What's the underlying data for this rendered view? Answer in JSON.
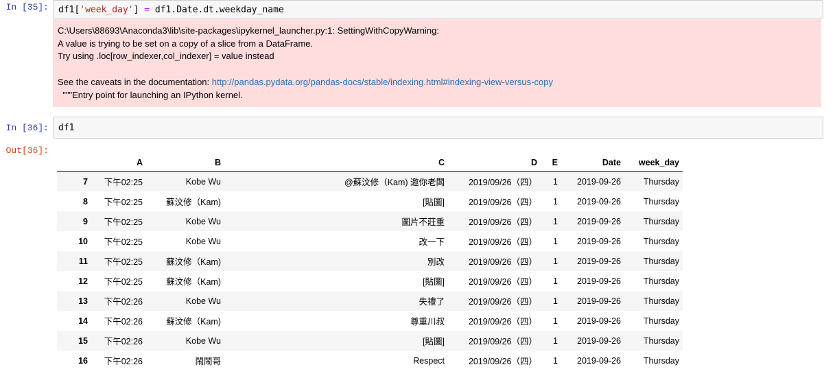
{
  "cell35": {
    "prompt": "In [35]:",
    "code": {
      "p1": "df1[",
      "p2": "'week_day'",
      "p3": "] ",
      "p4": "=",
      "p5": " df1.Date.dt.weekday_name"
    },
    "stderr": {
      "line1": "C:\\Users\\88693\\Anaconda3\\lib\\site-packages\\ipykernel_launcher.py:1: SettingWithCopyWarning:",
      "line2": "A value is trying to be set on a copy of a slice from a DataFrame.",
      "line3": "Try using .loc[row_indexer,col_indexer] = value instead",
      "line4_prefix": "See the caveats in the documentation: ",
      "line4_link": "http://pandas.pydata.org/pandas-docs/stable/indexing.html#indexing-view-versus-copy",
      "line5": "  \"\"\"Entry point for launching an IPython kernel."
    }
  },
  "cell36": {
    "prompt": "In [36]:",
    "code": "df1",
    "out_prompt": "Out[36]:"
  },
  "table": {
    "columns": [
      "",
      "A",
      "B",
      "C",
      "D",
      "E",
      "Date",
      "week_day"
    ],
    "rows": [
      [
        "7",
        "下午02:25",
        "Kobe Wu",
        "@蘇汶修（Kam) 邀你老闆",
        "2019/09/26（四）",
        "1",
        "2019-09-26",
        "Thursday"
      ],
      [
        "8",
        "下午02:25",
        "蘇汶修（Kam)",
        "[貼圖]",
        "2019/09/26（四）",
        "1",
        "2019-09-26",
        "Thursday"
      ],
      [
        "9",
        "下午02:25",
        "Kobe Wu",
        "圖片不莊重",
        "2019/09/26（四）",
        "1",
        "2019-09-26",
        "Thursday"
      ],
      [
        "10",
        "下午02:25",
        "Kobe Wu",
        "改一下",
        "2019/09/26（四）",
        "1",
        "2019-09-26",
        "Thursday"
      ],
      [
        "11",
        "下午02:25",
        "蘇汶修（Kam)",
        "別改",
        "2019/09/26（四）",
        "1",
        "2019-09-26",
        "Thursday"
      ],
      [
        "12",
        "下午02:25",
        "蘇汶修（Kam)",
        "[貼圖]",
        "2019/09/26（四）",
        "1",
        "2019-09-26",
        "Thursday"
      ],
      [
        "13",
        "下午02:26",
        "Kobe Wu",
        "失禮了",
        "2019/09/26（四）",
        "1",
        "2019-09-26",
        "Thursday"
      ],
      [
        "14",
        "下午02:26",
        "蘇汶修（Kam)",
        "尊重川叔",
        "2019/09/26（四）",
        "1",
        "2019-09-26",
        "Thursday"
      ],
      [
        "15",
        "下午02:26",
        "Kobe Wu",
        "[貼圖]",
        "2019/09/26（四）",
        "1",
        "2019-09-26",
        "Thursday"
      ],
      [
        "16",
        "下午02:26",
        "鬧鬧哥",
        "Respect",
        "2019/09/26（四）",
        "1",
        "2019-09-26",
        "Thursday"
      ]
    ]
  }
}
